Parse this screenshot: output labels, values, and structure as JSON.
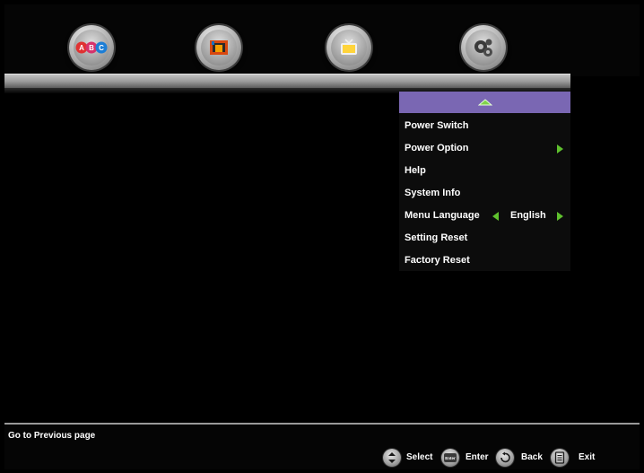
{
  "toolbar": {
    "icons": [
      "abc-icon",
      "photo-icon",
      "tv-icon",
      "gear-icon"
    ],
    "abc_letters": [
      "A",
      "B",
      "C"
    ],
    "colors": {
      "letter_a": "#e03131",
      "letter_b": "#d6336c",
      "letter_c": "#1c7ed6"
    }
  },
  "menu": {
    "up_icon": "up-arrow-icon",
    "highlight_color": "#7a67b3",
    "arrow_color": "#5fc12e",
    "items": [
      {
        "label": "Power Switch"
      },
      {
        "label": "Power Option"
      },
      {
        "label": "Help"
      },
      {
        "label": "System Info"
      },
      {
        "label": "Menu Language",
        "value": "English"
      },
      {
        "label": "Setting Reset"
      },
      {
        "label": "Factory Reset"
      }
    ]
  },
  "footer": {
    "hint": "Go to Previous page",
    "keys": {
      "select": "Select",
      "enter": "Enter",
      "enter_icon_text": "Enter",
      "back": "Back",
      "exit": "Exit"
    }
  }
}
